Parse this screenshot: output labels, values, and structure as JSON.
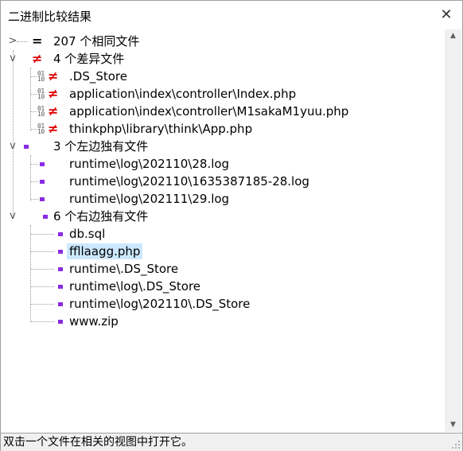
{
  "window": {
    "title": "二进制比较结果",
    "close_glyph": "✕"
  },
  "tree": {
    "identical": {
      "count_label": "207 个相同文件"
    },
    "different": {
      "count_label": "4 个差异文件",
      "items": [
        ".DS_Store",
        "application\\index\\controller\\Index.php",
        "application\\index\\controller\\M1sakaM1yuu.php",
        "thinkphp\\library\\think\\App.php"
      ]
    },
    "left_only": {
      "count_label": "3 个左边独有文件",
      "items": [
        "runtime\\log\\202110\\28.log",
        "runtime\\log\\202110\\1635387185-28.log",
        "runtime\\log\\202111\\29.log"
      ]
    },
    "right_only": {
      "count_label": "6 个右边独有文件",
      "items": [
        "db.sql",
        "ffllaagg.php",
        "runtime\\.DS_Store",
        "runtime\\log\\.DS_Store",
        "runtime\\log\\202110\\.DS_Store",
        "www.zip"
      ],
      "selected_index": 1
    }
  },
  "status": {
    "text": "双击一个文件在相关的视图中打开它。"
  },
  "colors": {
    "diff_symbol": "#e00000",
    "only_marker": "#8a2be2",
    "selection": "#cce8ff"
  },
  "icons": {
    "equal": "=",
    "not_equal": "≠",
    "binary": "01/10"
  }
}
